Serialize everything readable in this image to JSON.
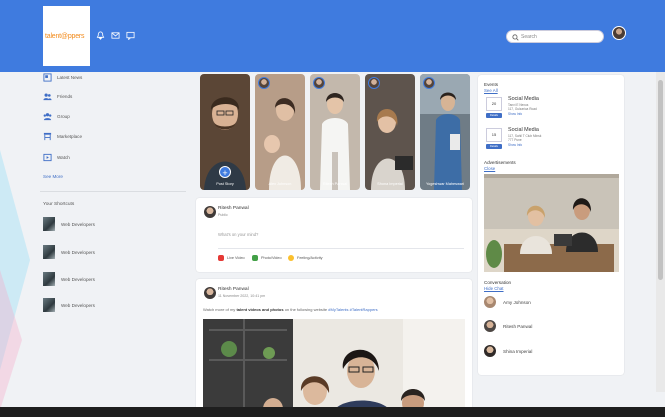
{
  "header": {
    "logo": "talent@ppers",
    "search_placeholder": "Search",
    "icons": [
      "bell-icon",
      "mail-icon",
      "chat-icon"
    ]
  },
  "sidebar": {
    "items": [
      {
        "label": "Latest News",
        "icon": "news-icon"
      },
      {
        "label": "Friends",
        "icon": "friends-icon"
      },
      {
        "label": "Group",
        "icon": "group-icon"
      },
      {
        "label": "Marketplace",
        "icon": "marketplace-icon"
      },
      {
        "label": "Watch",
        "icon": "watch-icon"
      }
    ],
    "see_more": "See More",
    "shortcuts_title": "Your Shortcuts",
    "shortcuts": [
      {
        "label": "Web Developers"
      },
      {
        "label": "Web Developers"
      },
      {
        "label": "Web Developers"
      },
      {
        "label": "Web Developers"
      }
    ]
  },
  "stories": [
    {
      "name": "Post Story",
      "bg": "#5b4636"
    },
    {
      "name": "Alex Johnson",
      "bg": "#b79d88"
    },
    {
      "name": "Ritesh Panwal",
      "bg": "#c3b8ac"
    },
    {
      "name": "Shona Imperial",
      "bg": "#5e544d"
    },
    {
      "name": "Yogeshwar Maheswari",
      "bg": "#6f7c86"
    }
  ],
  "composer": {
    "name": "Ritesh Panwal",
    "visibility": "Public",
    "prompt": "What's on your mind?",
    "actions": [
      {
        "label": "Live Video",
        "color": "#e53935"
      },
      {
        "label": "Photo/Video",
        "color": "#43a047"
      },
      {
        "label": "Feeling/Activity",
        "color": "#fbc02d"
      }
    ]
  },
  "post": {
    "name": "Ritesh Panwal",
    "date": "11 November 2022, 10:41 pm",
    "text_prefix": "Watch more of my",
    "text_bold": "talent videos and photos",
    "text_middle": "on the following website",
    "text_tags": "#MyTalents #TalentRappers"
  },
  "right_panel": {
    "events_title": "Events",
    "see_all": "See All",
    "events": [
      {
        "date": "20",
        "title": "Social Media",
        "line1": "Tanvi E Nexus",
        "line2": "117, Gulzarica Road",
        "more": "Show Info",
        "button": "Details"
      },
      {
        "date": "15",
        "title": "Social Media",
        "line1": "117, Sahil T Club Minsk",
        "line2": "777 Pune",
        "more": "Show Info",
        "button": "Details"
      }
    ],
    "ads_title": "Advertisements",
    "ads_close": "Close",
    "conversation_title": "Conversation",
    "hide_chat": "Hide Chat",
    "conversations": [
      {
        "name": "Amy Johnson",
        "color": "#a88870"
      },
      {
        "name": "Ritesh Panwal",
        "color": "#4d4744"
      },
      {
        "name": "Shina Imperial",
        "color": "#2f2a28"
      }
    ]
  }
}
